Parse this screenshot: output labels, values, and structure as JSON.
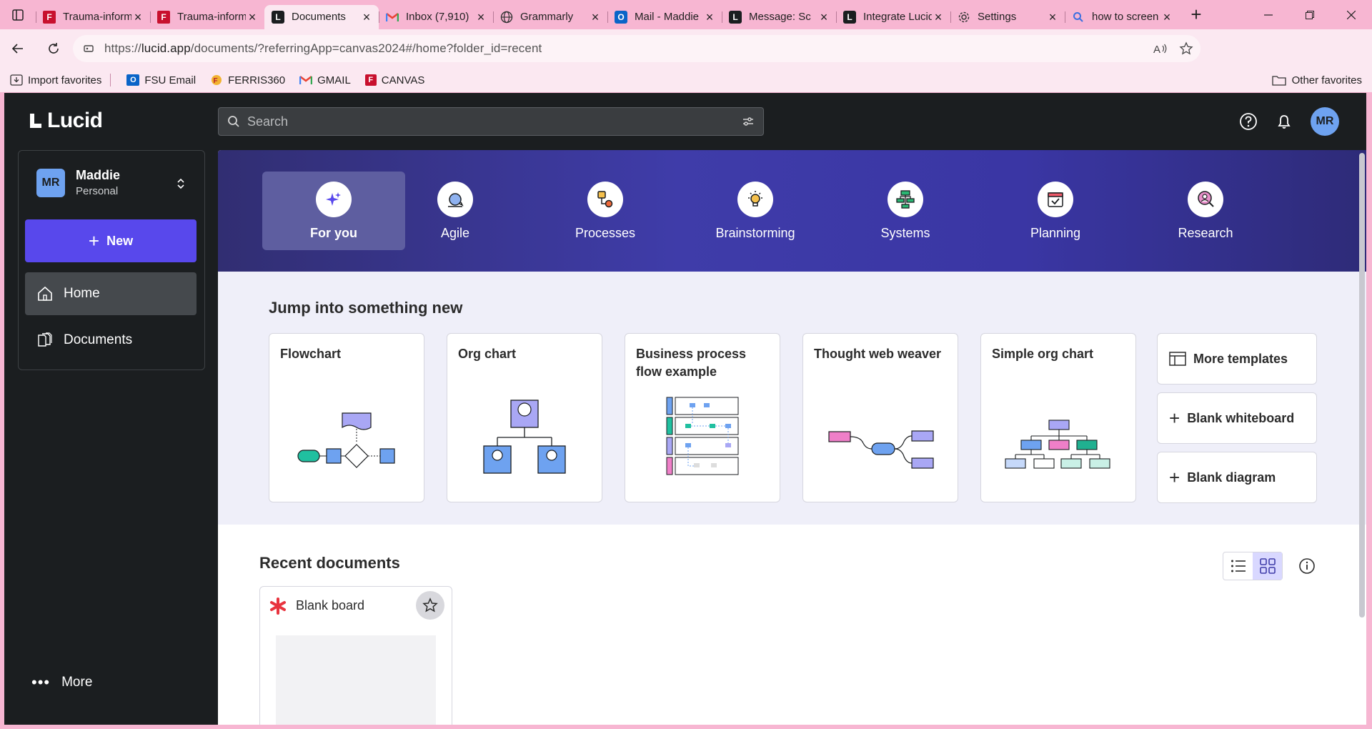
{
  "browser": {
    "tabs": [
      {
        "title": "Trauma-informed",
        "favicon": "ferris-icon",
        "active": false
      },
      {
        "title": "Trauma-informed",
        "favicon": "ferris-icon",
        "active": false
      },
      {
        "title": "Documents",
        "favicon": "lucid-icon",
        "active": true
      },
      {
        "title": "Inbox (7,910)",
        "favicon": "gmail-icon",
        "active": false
      },
      {
        "title": "Grammarly",
        "favicon": "globe-icon",
        "active": false
      },
      {
        "title": "Mail - Maddie",
        "favicon": "outlook-icon",
        "active": false
      },
      {
        "title": "Message: Sc",
        "favicon": "lucid-icon",
        "active": false
      },
      {
        "title": "Integrate Lucid",
        "favicon": "lucid-icon",
        "active": false
      },
      {
        "title": "Settings",
        "favicon": "gear-icon",
        "active": false
      },
      {
        "title": "how to screen",
        "favicon": "search-icon",
        "active": false
      }
    ],
    "url_prefix": "https://",
    "url_domain": "lucid.app",
    "url_path": "/documents/?referringApp=canvas2024#/home?folder_id=recent",
    "favorites": [
      {
        "label": "Import favorites",
        "icon": "import-icon"
      },
      {
        "label": "FSU Email",
        "icon": "outlook-icon"
      },
      {
        "label": "FERRIS360",
        "icon": "ferris360-icon"
      },
      {
        "label": "GMAIL",
        "icon": "gmail-icon"
      },
      {
        "label": "CANVAS",
        "icon": "ferris-icon"
      }
    ],
    "other_favorites": "Other favorites"
  },
  "app": {
    "logo": "Lucid",
    "search_placeholder": "Search",
    "user_initials": "MR",
    "account": {
      "name": "Maddie",
      "plan": "Personal",
      "initials": "MR"
    },
    "new_button": "New",
    "nav": [
      {
        "label": "Home",
        "icon": "home-icon",
        "selected": true
      },
      {
        "label": "Documents",
        "icon": "documents-icon",
        "selected": false
      }
    ],
    "more": "More",
    "categories": [
      {
        "label": "For you",
        "icon": "sparkle-icon",
        "selected": true
      },
      {
        "label": "Agile",
        "icon": "cycle-icon",
        "selected": false
      },
      {
        "label": "Processes",
        "icon": "process-icon",
        "selected": false
      },
      {
        "label": "Brainstorming",
        "icon": "lightbulb-icon",
        "selected": false
      },
      {
        "label": "Systems",
        "icon": "network-icon",
        "selected": false
      },
      {
        "label": "Planning",
        "icon": "calendar-check-icon",
        "selected": false
      },
      {
        "label": "Research",
        "icon": "magnifier-person-icon",
        "selected": false
      }
    ],
    "jump_title": "Jump into something new",
    "templates": [
      {
        "title": "Flowchart"
      },
      {
        "title": "Org chart"
      },
      {
        "title": "Business process flow example"
      },
      {
        "title": "Thought web weaver"
      },
      {
        "title": "Simple org chart"
      }
    ],
    "side_actions": [
      {
        "label": "More templates",
        "icon": "templates-icon"
      },
      {
        "label": "Blank whiteboard",
        "icon": "plus-icon"
      },
      {
        "label": "Blank diagram",
        "icon": "plus-icon"
      }
    ],
    "recent_title": "Recent documents",
    "recent_docs": [
      {
        "title": "Blank board",
        "icon": "lucidspark-icon"
      }
    ],
    "colors": {
      "sidebar_bg": "#1b1e20",
      "new_button": "#5848ec",
      "hero_bg": "#3a36a4",
      "jump_bg": "#efeff9",
      "browser_chrome": "#f7b6d2"
    }
  }
}
